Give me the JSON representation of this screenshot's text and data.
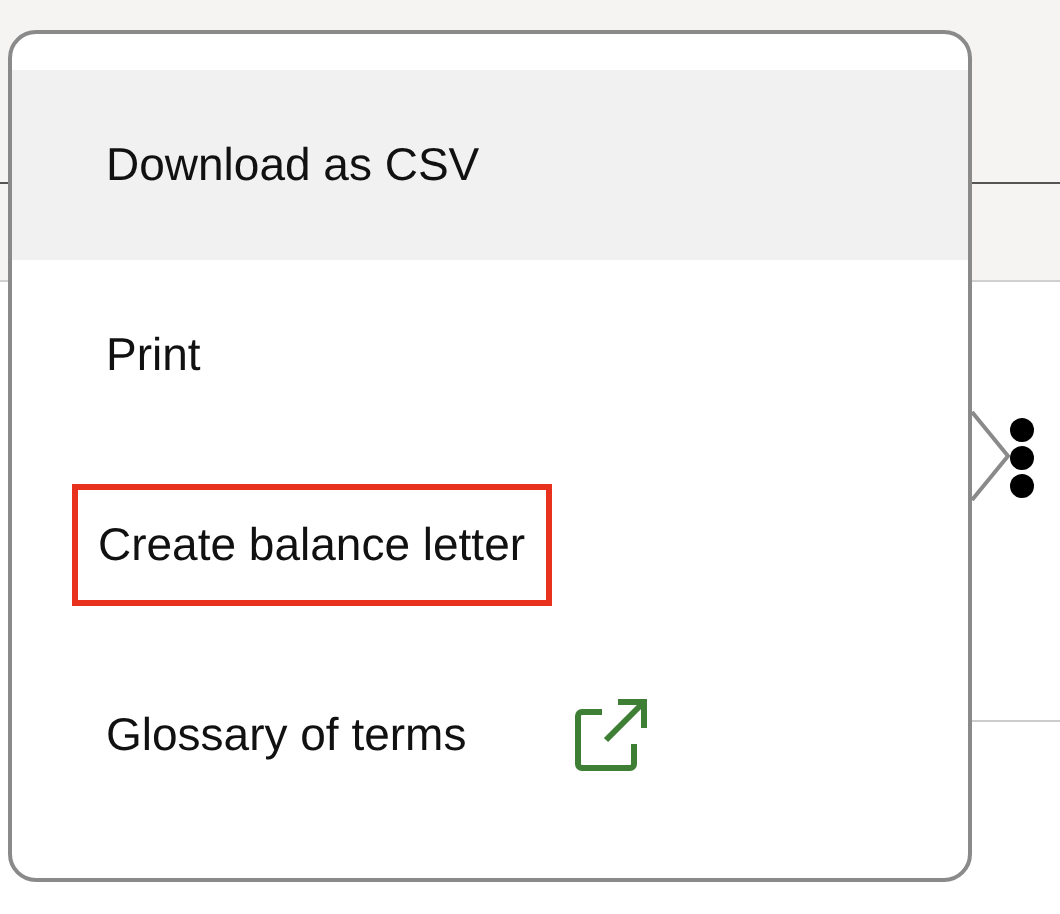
{
  "menu": {
    "items": [
      {
        "label": "Download as CSV",
        "kind": "action",
        "highlighted": true,
        "annotated": false
      },
      {
        "label": "Print",
        "kind": "action",
        "highlighted": false,
        "annotated": false
      },
      {
        "label": "Create balance letter",
        "kind": "action",
        "highlighted": false,
        "annotated": true
      },
      {
        "label": "Glossary of terms",
        "kind": "external-link",
        "highlighted": false,
        "annotated": false
      }
    ]
  }
}
